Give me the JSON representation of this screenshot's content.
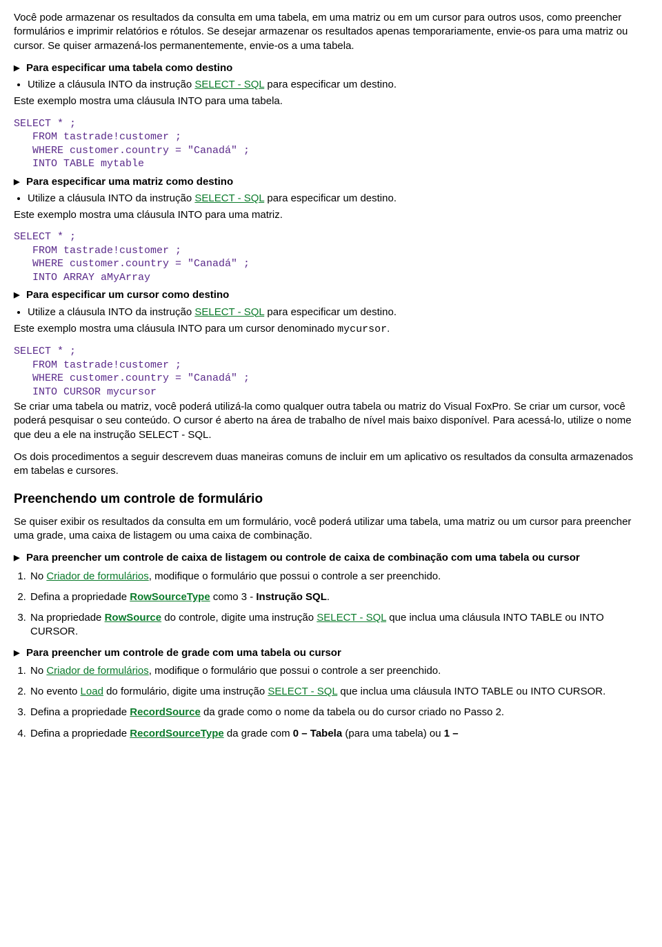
{
  "intro1": "Você pode armazenar os resultados da consulta em uma tabela, em uma matriz ou em um cursor para outros usos, como preencher formulários e imprimir relatórios e rótulos. Se desejar armazenar os resultados apenas temporariamente, envie-os para uma matriz ou cursor. Se quiser armazená-los permanentemente, envie-os a uma tabela.",
  "sec1_head": "Para especificar uma tabela como destino",
  "sec1_b1a": "Utilize a cláusula INTO da instrução ",
  "sec1_b1_link": "SELECT - SQL",
  "sec1_b1b": " para especificar um destino.",
  "sec1_p": "Este exemplo mostra uma cláusula INTO para uma tabela.",
  "code1": "SELECT * ;\n   FROM tastrade!customer ;\n   WHERE customer.country = \"Canadá\" ;\n   INTO TABLE mytable",
  "sec2_head": "Para especificar uma matriz como destino",
  "sec2_b1a": "Utilize a cláusula INTO da instrução ",
  "sec2_b1_link": "SELECT - SQL",
  "sec2_b1b": " para especificar um destino.",
  "sec2_p": "Este exemplo mostra uma cláusula INTO para uma matriz.",
  "code2": "SELECT * ;\n   FROM tastrade!customer ;\n   WHERE customer.country = \"Canadá\" ;\n   INTO ARRAY aMyArray",
  "sec3_head": "Para especificar um cursor como destino",
  "sec3_b1a": "Utilize a cláusula INTO da instrução ",
  "sec3_b1_link": "SELECT - SQL",
  "sec3_b1b": " para especificar um destino.",
  "sec3_p_a": "Este exemplo mostra uma cláusula INTO para um cursor denominado ",
  "sec3_p_mono": "mycursor",
  "sec3_p_b": ".",
  "code3": "SELECT * ;\n   FROM tastrade!customer ;\n   WHERE customer.country = \"Canadá\" ;\n   INTO CURSOR mycursor",
  "after1": "Se criar uma tabela ou matriz, você poderá utilizá-la como qualquer outra tabela ou matriz do Visual FoxPro. Se criar um cursor, você poderá pesquisar o seu conteúdo. O cursor é aberto na área de trabalho de nível mais baixo disponível. Para acessá-lo, utilize o nome que deu a ele na instrução SELECT - SQL.",
  "after2": "Os dois procedimentos a seguir descrevem duas maneiras comuns de incluir em um aplicativo os resultados da consulta armazenados em tabelas e cursores.",
  "heading2": "Preenchendo um controle de formulário",
  "par_form": "Se quiser exibir os resultados da consulta em um formulário, você poderá utilizar uma tabela, uma matriz ou um cursor para preencher uma grade, uma caixa de listagem ou uma caixa de combinação.",
  "tri4": "Para preencher um controle de caixa de listagem ou controle de caixa de combinação com uma tabela ou cursor",
  "s4_1a": "No ",
  "s4_1_link": "Criador de formulários",
  "s4_1b": ", modifique o formulário que possui o controle a ser preenchido.",
  "s4_2a": "Defina a propriedade ",
  "s4_2_link": "RowSourceType",
  "s4_2b": " como 3 - ",
  "s4_2c": "Instrução SQL",
  "s4_2d": ".",
  "s4_3a": "Na propriedade ",
  "s4_3_link": "RowSource",
  "s4_3b": " do controle, digite uma instrução ",
  "s4_3_link2": "SELECT - SQL",
  "s4_3c": " que inclua uma cláusula INTO TABLE ou INTO CURSOR.",
  "tri5": "Para preencher um controle de grade com uma tabela ou cursor",
  "s5_1a": "No ",
  "s5_1_link": "Criador de formulários",
  "s5_1b": ", modifique o formulário que possui o controle a ser preenchido.",
  "s5_2a": "No evento ",
  "s5_2_link": "Load",
  "s5_2b": " do formulário, digite uma instrução ",
  "s5_2_link2": "SELECT - SQL",
  "s5_2c": " que inclua uma cláusula INTO TABLE ou INTO CURSOR.",
  "s5_3a": "Defina a propriedade ",
  "s5_3_link": "RecordSource",
  "s5_3b": " da grade como o nome da tabela ou do cursor criado no Passo 2.",
  "s5_4a": "Defina a propriedade ",
  "s5_4_link": "RecordSourceType",
  "s5_4b": " da grade com ",
  "s5_4c": "0 – Tabela",
  "s5_4d": " (para uma tabela) ou ",
  "s5_4e": "1 –"
}
